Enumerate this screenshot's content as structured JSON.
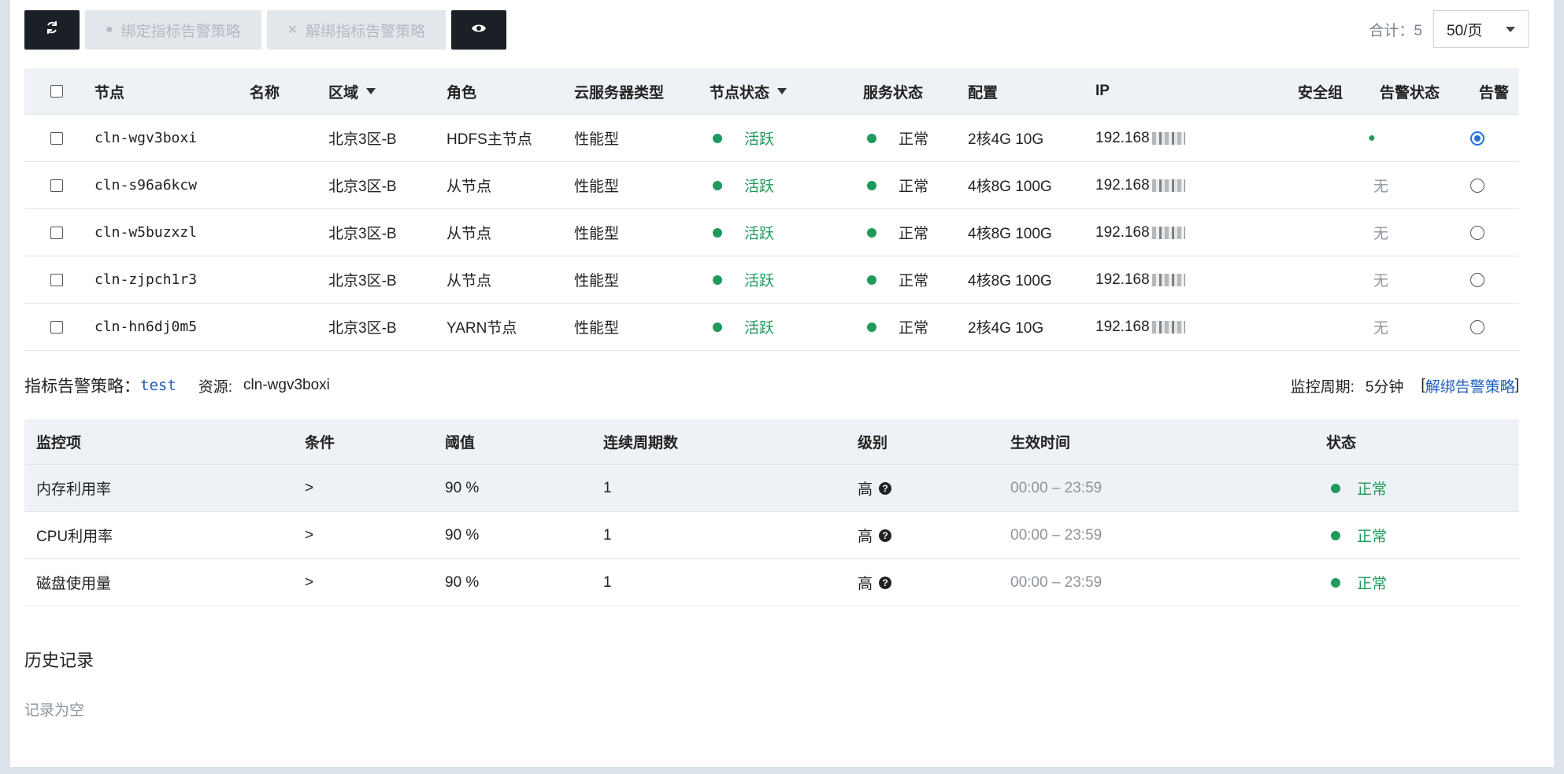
{
  "toolbar": {
    "refresh_icon": "refresh-icon",
    "bind_label": "绑定指标告警策略",
    "unbind_label": "解绑指标告警策略",
    "view_icon": "eye-icon"
  },
  "pager": {
    "total": "合计：5",
    "page_size": "50/页"
  },
  "node_table": {
    "headers": {
      "node": "节点",
      "name": "名称",
      "region": "区域",
      "role": "角色",
      "type": "云服务器类型",
      "node_status": "节点状态",
      "service_status": "服务状态",
      "config": "配置",
      "ip": "IP",
      "security_group": "安全组",
      "alert_status": "告警状态",
      "alert": "告警"
    },
    "rows": [
      {
        "node": "cln-wgv3boxi",
        "name": "",
        "region": "北京3区-B",
        "role": "HDFS主节点",
        "type": "性能型",
        "node_status": "活跃",
        "service_status": "正常",
        "config": "2核4G 10G",
        "ip": "192.168",
        "alert_status": "",
        "selected": true
      },
      {
        "node": "cln-s96a6kcw",
        "name": "",
        "region": "北京3区-B",
        "role": "从节点",
        "type": "性能型",
        "node_status": "活跃",
        "service_status": "正常",
        "config": "4核8G 100G",
        "ip": "192.168",
        "alert_status": "无",
        "selected": false
      },
      {
        "node": "cln-w5buzxzl",
        "name": "",
        "region": "北京3区-B",
        "role": "从节点",
        "type": "性能型",
        "node_status": "活跃",
        "service_status": "正常",
        "config": "4核8G 100G",
        "ip": "192.168",
        "alert_status": "无",
        "selected": false
      },
      {
        "node": "cln-zjpch1r3",
        "name": "",
        "region": "北京3区-B",
        "role": "从节点",
        "type": "性能型",
        "node_status": "活跃",
        "service_status": "正常",
        "config": "4核8G 100G",
        "ip": "192.168",
        "alert_status": "无",
        "selected": false
      },
      {
        "node": "cln-hn6dj0m5",
        "name": "",
        "region": "北京3区-B",
        "role": "YARN节点",
        "type": "性能型",
        "node_status": "活跃",
        "service_status": "正常",
        "config": "2核4G 10G",
        "ip": "192.168",
        "alert_status": "无",
        "selected": false
      }
    ]
  },
  "policy": {
    "label": "指标告警策略：",
    "name": "test",
    "resource_label": "资源:",
    "resource": "cln-wgv3boxi",
    "period_label": "监控周期:",
    "period": "5分钟",
    "bracket_open": "[",
    "unbind_link": "解绑告警策略",
    "bracket_close": "]"
  },
  "metric_table": {
    "headers": {
      "item": "监控项",
      "cond": "条件",
      "threshold": "阈值",
      "periods": "连续周期数",
      "level": "级别",
      "time": "生效时间",
      "status": "状态"
    },
    "rows": [
      {
        "item": "内存利用率",
        "cond": ">",
        "threshold": "90 %",
        "periods": "1",
        "level": "高",
        "time": "00:00 – 23:59",
        "status": "正常"
      },
      {
        "item": "CPU利用率",
        "cond": ">",
        "threshold": "90 %",
        "periods": "1",
        "level": "高",
        "time": "00:00 – 23:59",
        "status": "正常"
      },
      {
        "item": "磁盘使用量",
        "cond": ">",
        "threshold": "90 %",
        "periods": "1",
        "level": "高",
        "time": "00:00 – 23:59",
        "status": "正常"
      }
    ]
  },
  "history": {
    "title": "历史记录",
    "empty": "记录为空"
  },
  "colors": {
    "accent_green": "#1f9a5c",
    "link_blue": "#1f5fbf",
    "dark_button": "#1b2026"
  }
}
